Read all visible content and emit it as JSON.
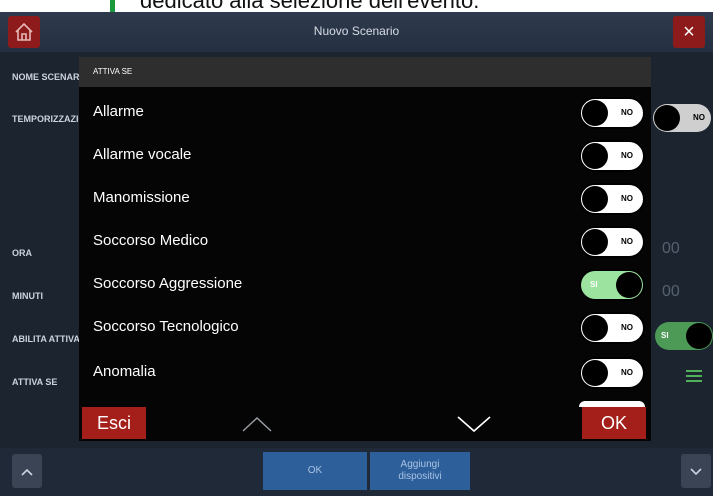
{
  "caption": "dedicato alla selezione dell'evento.",
  "app": {
    "title": "Nuovo Scenario",
    "close_label": "×",
    "row_labels": [
      "NOME SCENARIO",
      "TEMPORIZZAZIONE",
      "ORA",
      "MINUTI",
      "ABILITA ATTIVAZIONE",
      "ATTIVA SE"
    ],
    "bg_temporizzazione": "NO",
    "bg_abilita": "SI",
    "digits": [
      "00",
      "00"
    ],
    "bottom": {
      "ok_label": "OK",
      "add_line1": "Aggiungi",
      "add_line2": "dispositivi"
    }
  },
  "modal": {
    "header": "ATTIVA SE",
    "items": [
      {
        "label": "Allarme",
        "state": "NO"
      },
      {
        "label": "Allarme vocale",
        "state": "NO"
      },
      {
        "label": "Manomissione",
        "state": "NO"
      },
      {
        "label": "Soccorso Medico",
        "state": "NO"
      },
      {
        "label": "Soccorso Aggressione",
        "state": "SI"
      },
      {
        "label": "Soccorso Tecnologico",
        "state": "NO"
      },
      {
        "label": "Anomalia",
        "state": "NO"
      }
    ],
    "esci_label": "Esci",
    "ok_label": "OK"
  },
  "colors": {
    "accent_red": "#a51f1a",
    "toggle_on": "#9be39e",
    "arrow_green": "#1a9a3a",
    "bottom_blue": "#2d5f9a"
  }
}
